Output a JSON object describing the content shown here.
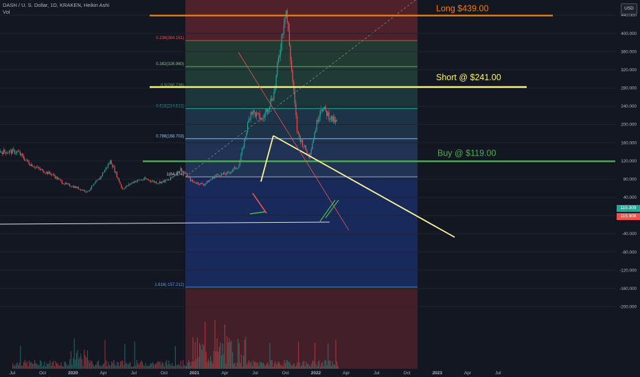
{
  "header": {
    "symbol_line": "DASH / U. S. Dollar, 1D, KRAKEN, Heikin Ashi",
    "vol_label": "Vol"
  },
  "currency_button": "USD",
  "price_tags": {
    "current_upper": "115.309",
    "current_lower": "115.908"
  },
  "colors": {
    "background": "#131722",
    "candle_up": "#26a69a",
    "candle_down": "#ef5350",
    "long_line": "#f57c00",
    "short_line": "#fff176",
    "buy_line": "#4caf50",
    "trendline": "#fff59d",
    "zone_blue": "#1e3a8a"
  },
  "chart_data": {
    "type": "candlestick",
    "y_axis": {
      "min": -220,
      "max": 560,
      "tick_labels": [
        "560.000",
        "520.000",
        "480.000",
        "440.000",
        "400.000",
        "360.000",
        "320.000",
        "280.000",
        "240.000",
        "200.000",
        "160.000",
        "120.000",
        "80.000",
        "40.000",
        "0.000",
        "-40.000",
        "-80.000",
        "-120.000",
        "-160.000",
        "-200.000"
      ]
    },
    "x_axis": {
      "tick_labels": [
        "Jul",
        "Oct",
        "2020",
        "Apr",
        "Jul",
        "Oct",
        "2021",
        "Apr",
        "Jul",
        "Oct",
        "2022",
        "Apr",
        "Jul",
        "Oct",
        "2023",
        "Apr",
        "Jul"
      ]
    },
    "fib_levels": [
      {
        "ratio": "0",
        "label": "0(476.598)",
        "value": 476.598
      },
      {
        "ratio": "0.236",
        "label": "0.236(384.151)",
        "value": 384.151
      },
      {
        "ratio": "0.382",
        "label": "0.382(326.960)",
        "value": 326.96
      },
      {
        "ratio": "0.5",
        "label": "0.5(280.736)",
        "value": 280.736
      },
      {
        "ratio": "0.618",
        "label": "0.618(234.513)",
        "value": 234.513
      },
      {
        "ratio": "0.786",
        "label": "0.786(168.703)",
        "value": 168.703
      },
      {
        "ratio": "1",
        "label": "1(84.874)",
        "value": 84.874
      },
      {
        "ratio": "1.618",
        "label": "1.618(-157.212)",
        "value": -157.212
      }
    ],
    "annotations": [
      {
        "label": "Long $439.00",
        "value": 439
      },
      {
        "label": "Short @ $241.00",
        "value": 282
      },
      {
        "label": "Buy @ $119.00",
        "value": 119
      }
    ],
    "price_series": [
      [
        "2019-06",
        140
      ],
      [
        "2019-07",
        115
      ],
      [
        "2019-08",
        100
      ],
      [
        "2019-09",
        90
      ],
      [
        "2019-10",
        70
      ],
      [
        "2019-11",
        62
      ],
      [
        "2019-12",
        52
      ],
      [
        "2020-01",
        80
      ],
      [
        "2020-02",
        120
      ],
      [
        "2020-03",
        58
      ],
      [
        "2020-04",
        75
      ],
      [
        "2020-05",
        80
      ],
      [
        "2020-06",
        72
      ],
      [
        "2020-07",
        78
      ],
      [
        "2020-08",
        102
      ],
      [
        "2020-09",
        74
      ],
      [
        "2020-10",
        68
      ],
      [
        "2020-11",
        88
      ],
      [
        "2020-12",
        92
      ],
      [
        "2021-01",
        110
      ],
      [
        "2021-02",
        230
      ],
      [
        "2021-03",
        210
      ],
      [
        "2021-04",
        270
      ],
      [
        "2021-05",
        460
      ],
      [
        "2021-06",
        180
      ],
      [
        "2021-07",
        130
      ],
      [
        "2021-08",
        240
      ],
      [
        "2021-09",
        210
      ],
      [
        "2021-10",
        190
      ],
      [
        "2021-11",
        215
      ],
      [
        "2021-12",
        140
      ],
      [
        "2022-01",
        120
      ],
      [
        "2022-02",
        105
      ],
      [
        "2022-03",
        116
      ]
    ]
  }
}
